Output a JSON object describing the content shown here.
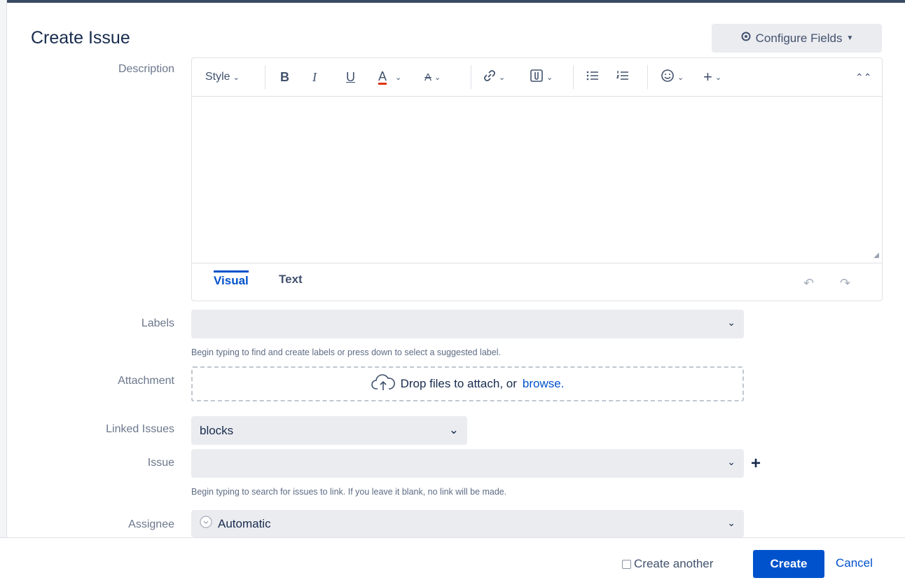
{
  "header": {
    "title": "Create Issue",
    "configure_fields_label": "Configure Fields"
  },
  "description": {
    "label": "Description",
    "toolbar": {
      "style_label": "Style",
      "bold": "B",
      "italic": "I",
      "underline": "U",
      "text_color": "A"
    },
    "tabs": [
      {
        "label": "Visual",
        "active": true
      },
      {
        "label": "Text",
        "active": false
      }
    ]
  },
  "labels_field": {
    "label": "Labels",
    "value": "",
    "help": "Begin typing to find and create labels or press down to select a suggested label."
  },
  "attachment": {
    "label": "Attachment",
    "drop_text": "Drop files to attach, or",
    "browse_link": "browse."
  },
  "linked_issues": {
    "label": "Linked Issues",
    "value": "blocks"
  },
  "issue_field": {
    "label": "Issue",
    "value": "",
    "help": "Begin typing to search for issues to link. If you leave it blank, no link will be made."
  },
  "assignee": {
    "label": "Assignee",
    "value": "Automatic"
  },
  "footer": {
    "create_another_label": "Create another",
    "create_another_checked": false,
    "create_label": "Create",
    "cancel_label": "Cancel"
  },
  "colors": {
    "primary": "#0052cc",
    "field_bg": "#ebecf0",
    "label_gray": "#6b778c"
  }
}
